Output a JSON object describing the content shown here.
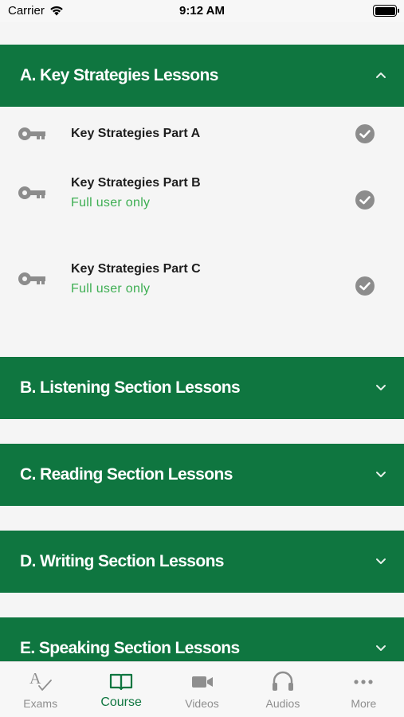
{
  "status_bar": {
    "carrier": "Carrier",
    "time": "9:12 AM"
  },
  "colors": {
    "header_green": "#0f7640",
    "note_green": "#3dae52",
    "icon_gray": "#8c8c8c"
  },
  "sections": [
    {
      "title": "A. Key Strategies Lessons",
      "expanded": true,
      "chevron": "chevron-up-icon"
    },
    {
      "title": "B. Listening Section Lessons",
      "expanded": false,
      "chevron": "chevron-down-icon"
    },
    {
      "title": "C. Reading Section Lessons",
      "expanded": false,
      "chevron": "chevron-down-icon"
    },
    {
      "title": "D. Writing Section Lessons",
      "expanded": false,
      "chevron": "chevron-down-icon"
    },
    {
      "title": "E. Speaking Section Lessons",
      "expanded": false,
      "chevron": "chevron-down-icon"
    }
  ],
  "lessons": [
    {
      "name": "Key Strategies Part A",
      "note": "",
      "icon": "key-icon",
      "status_icon": "check-circle-icon"
    },
    {
      "name": "Key Strategies Part B",
      "note": "Full user only",
      "icon": "key-icon",
      "status_icon": "check-circle-icon"
    },
    {
      "name": "Key Strategies Part C",
      "note": "Full user only",
      "icon": "key-icon",
      "status_icon": "check-circle-icon"
    }
  ],
  "tabs": [
    {
      "label": "Exams",
      "icon": "exams-icon",
      "active": false
    },
    {
      "label": "Course",
      "icon": "book-icon",
      "active": true
    },
    {
      "label": "Videos",
      "icon": "video-camera-icon",
      "active": false
    },
    {
      "label": "Audios",
      "icon": "headphones-icon",
      "active": false
    },
    {
      "label": "More",
      "icon": "more-dots-icon",
      "active": false
    }
  ]
}
